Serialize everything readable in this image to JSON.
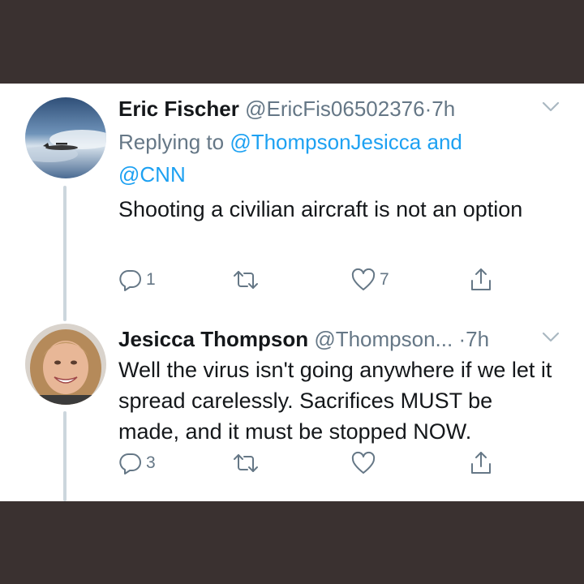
{
  "colors": {
    "frame": "#3a3130",
    "text": "#14171a",
    "secondary": "#657786",
    "link": "#1da1f2",
    "thread": "#ccd6dd"
  },
  "tweets": [
    {
      "name": "Eric Fischer",
      "handle": "@EricFis06502376",
      "separator": "·",
      "time": "7h",
      "replying_prefix": "Replying to",
      "reply_handle_1": "@ThompsonJesicca",
      "reply_conjunction": "and",
      "reply_handle_2": "@CNN",
      "text": "Shooting a civilian aircraft is not an option",
      "reply_count": "1",
      "retweet_count": "",
      "like_count": "7",
      "icons": [
        "airplane-avatar",
        "chevron-down-icon",
        "reply-icon",
        "retweet-icon",
        "heart-icon",
        "share-icon"
      ]
    },
    {
      "name": "Jesicca Thompson",
      "handle": "@Thompson...",
      "separator": "·",
      "time": "7h",
      "text": "Well the virus isn't going anywhere if we let it spread carelessly. Sacrifices MUST be made, and it must be stopped NOW.",
      "reply_count": "3",
      "retweet_count": "",
      "like_count": "",
      "icons": [
        "profile-photo-avatar",
        "chevron-down-icon",
        "reply-icon",
        "retweet-icon",
        "heart-icon",
        "share-icon"
      ]
    }
  ]
}
